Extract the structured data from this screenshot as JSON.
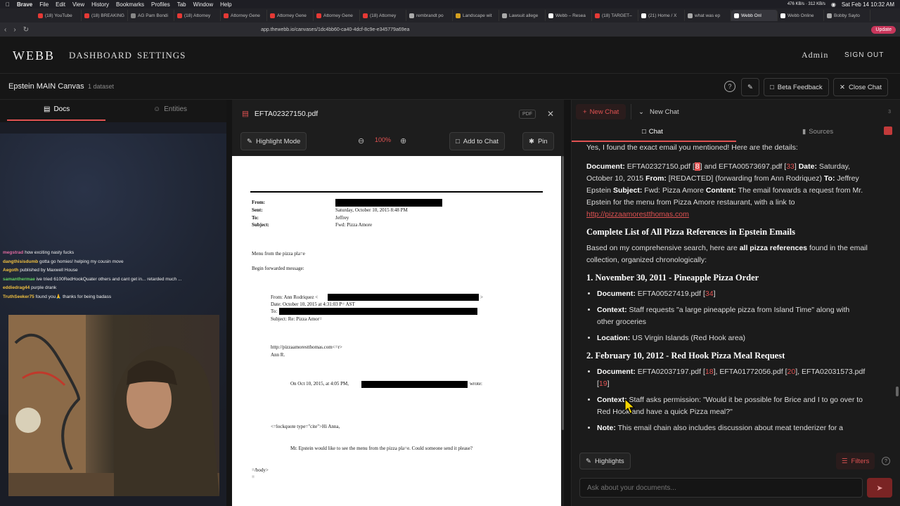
{
  "os": {
    "app_name": "Brave",
    "menus": [
      "File",
      "Edit",
      "View",
      "History",
      "Bookmarks",
      "Profiles",
      "Tab",
      "Window",
      "Help"
    ],
    "network": "476 KB/s · 312 KB/s",
    "clock": "Sat Feb 14  10:32 AM"
  },
  "browser": {
    "tabs": [
      {
        "label": "(18) YouTube",
        "color": "#e53935"
      },
      {
        "label": "(18) BREAKING",
        "color": "#e53935"
      },
      {
        "label": "AG Pam Bondi",
        "color": "#888888"
      },
      {
        "label": "(18) Attorney",
        "color": "#e53935"
      },
      {
        "label": "Attorney Gene",
        "color": "#e53935"
      },
      {
        "label": "Attorney Gene",
        "color": "#e53935"
      },
      {
        "label": "Attorney Gene",
        "color": "#e53935"
      },
      {
        "label": "(18) Attorney",
        "color": "#e53935"
      },
      {
        "label": "rembrandt po",
        "color": "#aaaaaa"
      },
      {
        "label": "Landscape wit",
        "color": "#d4a020"
      },
      {
        "label": "Lawsuit allege",
        "color": "#aaaaaa"
      },
      {
        "label": "Webb – Resea",
        "color": "#ffffff"
      },
      {
        "label": "(18) TARGET–",
        "color": "#e53935"
      },
      {
        "label": "(21) Home / X",
        "color": "#ffffff"
      },
      {
        "label": "what was ep",
        "color": "#aaaaaa"
      },
      {
        "label": "Webb Onl",
        "color": "#ffffff",
        "active": true
      },
      {
        "label": "Webb Online",
        "color": "#ffffff"
      },
      {
        "label": "Bobby Sayto",
        "color": "#aaaaaa"
      }
    ],
    "url": "app.thewebb.io/canvases/1dc4bb60-ca40-4dcf-8c9e-e345779a69ea",
    "update_label": "Update"
  },
  "app": {
    "logo": "WEBB",
    "nav": {
      "dashboard": "DASHBOARD",
      "settings": "SETTINGS"
    },
    "admin": "Admin",
    "signout": "SIGN OUT",
    "canvas_title": "Epstein MAIN Canvas",
    "dataset_count": "1 dataset",
    "beta_feedback": "Beta Feedback",
    "close_chat": "Close Chat"
  },
  "left": {
    "tab_docs": "Docs",
    "tab_entities": "Entities",
    "stream_chat": [
      {
        "user": "megstrad",
        "color": "#e06aa0",
        "msg": "how exciting nasty fucks"
      },
      {
        "user": "dangthisisdumb",
        "color": "#f0c040",
        "msg": "gotta go homies! helping my cousin move"
      },
      {
        "user": "Aegoth",
        "color": "#f0c040",
        "msg": "published by Maxwell House"
      },
      {
        "user": "samanthermae",
        "color": "#60d060",
        "msg": "ive tried 6100RedHookQuater others and cant get in... retarded much ..."
      },
      {
        "user": "eddiedrag44",
        "color": "#f0c040",
        "msg": "purple drank"
      },
      {
        "user": "TruthSeeker75",
        "color": "#f0c040",
        "msg": "found you🙏 thanks for being badass"
      }
    ]
  },
  "pdf": {
    "filename": "EFTA02327150.pdf",
    "badge": "PDF",
    "highlight_mode": "Highlight Mode",
    "zoom": "100%",
    "add_to_chat": "Add to Chat",
    "pin": "Pin",
    "page": {
      "from_label": "From:",
      "sent_label": "Sent:",
      "to_label": "To:",
      "subject_label": "Subject:",
      "sent_value": "Saturday, October 10, 2015 8:48 PM",
      "to_value": "Jeffrey",
      "subject_value": "Fwd: Pizza Amore",
      "line1": "Menu from the pizza pla=e",
      "line2": "Begin forwarded message:",
      "fwd_from": "From: Ann Rodriquez <",
      "fwd_from_end": ">",
      "fwd_date": "Date: October 10, 2015 at 4:31:03 P= AST",
      "fwd_to": "To:",
      "fwd_subject": "Subject: Re: Pizza Amor=",
      "fwd_url": "http://pizzaamorestthomas.com<=r>",
      "fwd_sign": "Ann R.",
      "on_date": "On Oct 10, 2015, at 4:05 PM,",
      "wrote": "wrote:",
      "quote_tag": "<=lockquote type=\"cite\">Hi Anna,",
      "quote_body": "Mr. Epstein would like to see the menu from the pizza pla=e. Could someone send it please?",
      "body_end": "=/body>",
      "eq": "="
    }
  },
  "chat": {
    "new_chat_button": "New Chat",
    "chat_selector": "New Chat",
    "chat_count": "3",
    "tab_chat": "Chat",
    "tab_sources": "Sources",
    "intro": "Yes, I found the exact email you mentioned! Here are the details:",
    "detail": {
      "doc_label": "Document:",
      "doc1": "EFTA02327150.pdf",
      "ref1": "8",
      "and": "and",
      "doc2": "EFTA00573697.pdf",
      "ref2": "33",
      "date_label": "Date:",
      "date": "Saturday, October 10, 2015",
      "from_label": "From:",
      "from": "[REDACTED] (forwarding from Ann Rodriquez)",
      "to_label": "To:",
      "to": "Jeffrey Epstein",
      "subject_label": "Subject:",
      "subject": "Fwd: Pizza Amore",
      "content_label": "Content:",
      "content": "The email forwards a request from Mr. Epstein for the menu from Pizza Amore restaurant, with a link to",
      "link": "http://pizzaamorestthomas.com"
    },
    "list_heading": "Complete List of All Pizza References in Epstein Emails",
    "list_intro_pre": "Based on my comprehensive search, here are",
    "list_intro_bold": "all pizza references",
    "list_intro_post": "found in the email collection, organized chronologically:",
    "sec1": {
      "heading": "1. November 30, 2011 - Pineapple Pizza Order",
      "doc_label": "Document:",
      "doc": "EFTA00527419.pdf",
      "ref": "34",
      "ctx_label": "Context:",
      "ctx": "Staff requests \"a large pineapple pizza from Island Time\" along with other groceries",
      "loc_label": "Location:",
      "loc": "US Virgin Islands (Red Hook area)"
    },
    "sec2": {
      "heading": "2. February 10, 2012 - Red Hook Pizza Meal Request",
      "doc_label": "Document:",
      "doc_a": "EFTA02037197.pdf",
      "ref_a": "18",
      "doc_b": "EFTA01772056.pdf",
      "ref_b": "20",
      "doc_c": "EFTA02031573.pdf",
      "ref_c": "19",
      "ctx_label": "Context:",
      "ctx": "Staff asks permission: \"Would it be possible for Brice and I to go over to Red Hook and have a quick Pizza meal?\"",
      "note_label": "Note:",
      "note": "This email chain also includes discussion about meat tenderizer for a"
    },
    "highlights": "Highlights",
    "filters": "Filters",
    "input_placeholder": "Ask about your documents..."
  },
  "colors": {
    "accent": "#e05252",
    "bg": "#141414",
    "panel": "#1b1b1b"
  }
}
